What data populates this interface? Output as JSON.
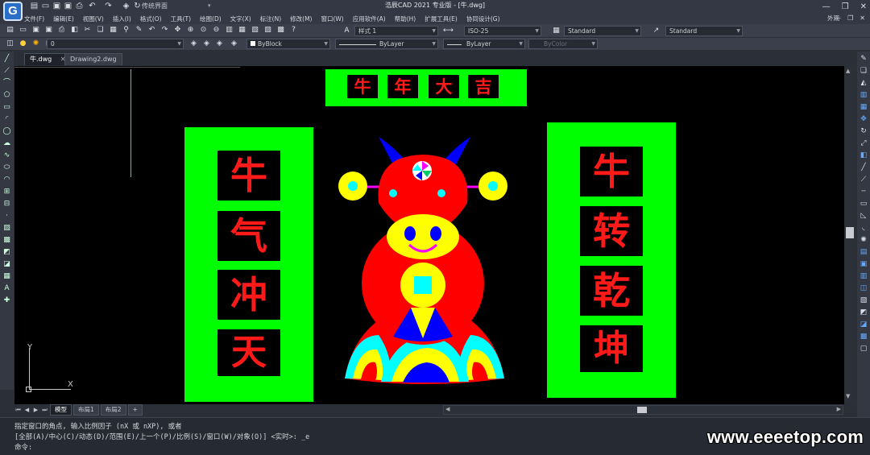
{
  "window": {
    "app_logo": "G",
    "workspace": "传统界面",
    "title": "浩辰CAD 2021 专业版 - [牛.dwg]",
    "controls": [
      "—",
      "❐",
      "✕"
    ]
  },
  "menu": {
    "items": [
      "文件(F)",
      "编辑(E)",
      "视图(V)",
      "插入(I)",
      "格式(O)",
      "工具(T)",
      "绘图(D)",
      "文字(X)",
      "标注(N)",
      "修改(M)",
      "窗口(W)",
      "应用软件(A)",
      "帮助(H)",
      "扩展工具(E)",
      "协同设计(G)"
    ],
    "appearance": "外观",
    "right_icons": [
      "—",
      "❐",
      "✕"
    ]
  },
  "toolbar1": {
    "text_style": "样式 1",
    "dim_style": "ISO-25",
    "table_style": "Standard",
    "multileader_style": "Standard"
  },
  "toolbar2": {
    "layer": "0",
    "color": "ByBlock",
    "linetype": "ByLayer",
    "lineweight": "ByLayer",
    "plotstyle": "ByColor"
  },
  "tabs": [
    {
      "label": "牛.dwg",
      "close": "✕"
    },
    {
      "label": "Drawing2.dwg",
      "close": ""
    }
  ],
  "layout_tabs": {
    "arrows": [
      "⏮",
      "◀",
      "▶",
      "⏭"
    ],
    "items": [
      "模型",
      "布局1",
      "布局2",
      "+"
    ]
  },
  "ucs": {
    "y": "Y",
    "x": "X"
  },
  "drawing": {
    "banner": [
      "牛",
      "年",
      "大",
      "吉"
    ],
    "left_couplet": [
      "牛",
      "气",
      "冲",
      "天"
    ],
    "right_couplet": [
      "牛",
      "转",
      "乾",
      "坤"
    ]
  },
  "command": {
    "line1": "指定窗口的角点, 输入比例因子 (nX 或 nXP), 或者",
    "line2": "[全部(A)/中心(C)/动态(D)/范围(E)/上一个(P)/比例(S)/窗口(W)/对象(O)] <实时>: _e",
    "line3": "命令:"
  },
  "watermark": "www.eeeetop.com",
  "colors": {
    "canvas": "#000000",
    "panel_green": "#00ff00",
    "text_red": "#ff1a1a",
    "ox_red": "#ff0000",
    "ox_yellow": "#ffff00",
    "ox_blue": "#0000ff",
    "ox_cyan": "#00ffff",
    "ox_magenta": "#ff00ff"
  },
  "icons": {
    "quick_access": [
      "new-file-icon",
      "open-icon",
      "save-icon",
      "save-as-icon",
      "print-icon",
      "undo-icon",
      "redo-icon",
      "cube-icon",
      "refresh-icon"
    ],
    "toolbar1": [
      "new-icon",
      "open-icon",
      "save-icon",
      "save-as-icon",
      "print-icon",
      "preview-icon",
      "cut-icon",
      "copy-icon",
      "paste-icon",
      "match-icon",
      "brush-icon",
      "undo-icon",
      "redo-icon",
      "pan-icon",
      "zoom-realtime-icon",
      "zoom-window-icon",
      "zoom-prev-icon",
      "properties-icon",
      "design-center-icon",
      "tool-palette-icon",
      "calculator-icon",
      "markup-icon",
      "help-icon"
    ],
    "toolbar2": [
      "layers-icon",
      "layer-on-icon",
      "layer-sun-icon",
      "layer-lock-icon",
      "layer-state-icon"
    ]
  }
}
